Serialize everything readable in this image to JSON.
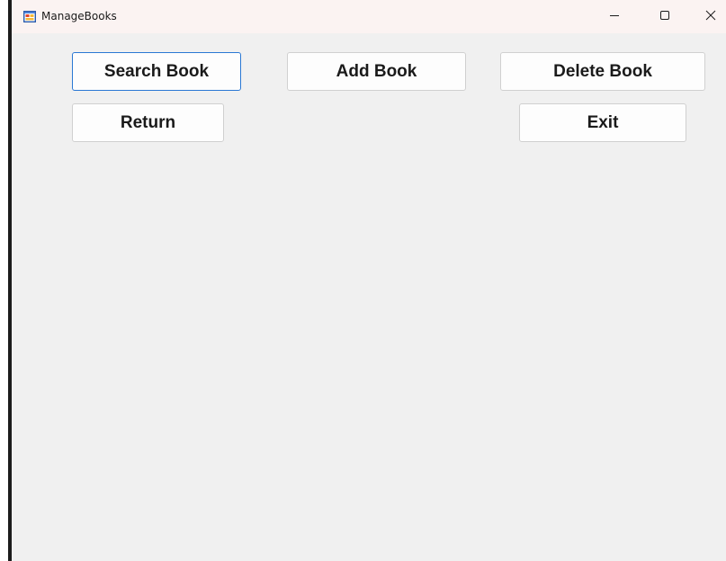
{
  "window": {
    "title": "ManageBooks",
    "controls": {
      "minimize_icon": "minimize-icon",
      "maximize_icon": "maximize-icon",
      "close_icon": "close-icon"
    }
  },
  "buttons": {
    "search_book": "Search Book",
    "add_book": "Add Book",
    "delete_book": "Delete Book",
    "return": "Return",
    "exit": "Exit"
  },
  "colors": {
    "titlebar_bg": "#fbf3f2",
    "form_bg": "#f0f0f0",
    "button_bg": "#fdfdfd",
    "focus_border": "#2a78d4"
  }
}
